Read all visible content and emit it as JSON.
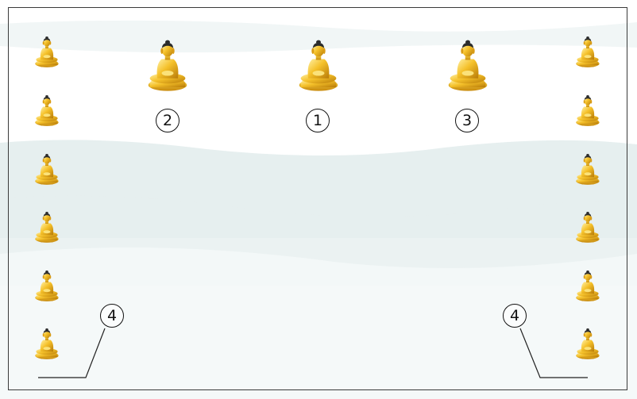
{
  "labels": {
    "center": "1",
    "left": "2",
    "right": "3",
    "bottom_left": "4",
    "bottom_right": "4"
  },
  "colors": {
    "gold_light": "#fbe27a",
    "gold": "#f2b21c",
    "gold_dark": "#b77a08",
    "hair": "#2c2c2c",
    "frame": "#3a3a3a",
    "mist": "#d6e6e6"
  },
  "icons": {
    "statue": "seated-buddha-statue-icon"
  }
}
